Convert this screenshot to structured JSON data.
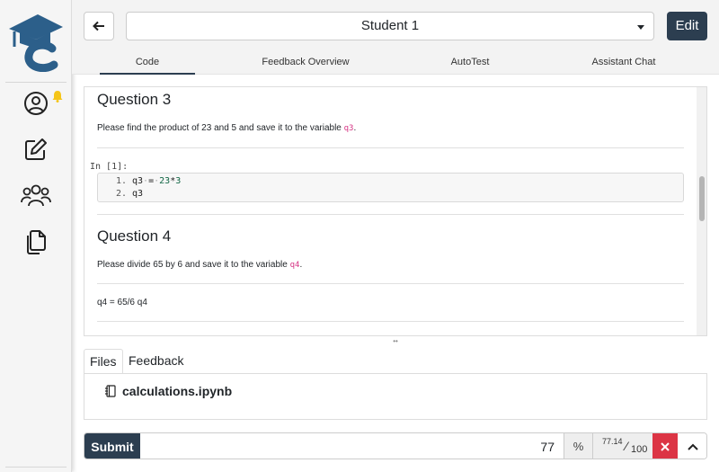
{
  "sidebar": {
    "logo": "codegrade-logo",
    "icons": [
      "user-icon",
      "notification-bell-icon",
      "edit-icon",
      "users-icon",
      "copy-icon"
    ],
    "accent": "#2c5f8a",
    "bell_color": "#f5c518"
  },
  "header": {
    "student": "Student 1",
    "edit_label": "Edit"
  },
  "tabs": [
    {
      "label": "Code",
      "active": true
    },
    {
      "label": "Feedback Overview"
    },
    {
      "label": "AutoTest"
    },
    {
      "label": "Assistant Chat"
    }
  ],
  "notebook": {
    "q3": {
      "title": "Question 3",
      "text_before": "Please find the product of 23 and 5 and save it to the variable ",
      "var": "q3",
      "text_after": "."
    },
    "prompt": "In [1]:",
    "code": [
      {
        "num": "1.",
        "code": "q3 = 23*3"
      },
      {
        "num": "2.",
        "code": "q3"
      }
    ],
    "q4": {
      "title": "Question 4",
      "text_before": "Please divide 65 by 6 and save it to the variable ",
      "var": "q4",
      "text_after": ".",
      "answer": "q4 = 65/6 q4"
    }
  },
  "file_tabs": [
    {
      "label": "Files",
      "active": true
    },
    {
      "label": "Feedback"
    }
  ],
  "files": [
    {
      "name": "calculations.ipynb",
      "icon": "notebook-icon"
    }
  ],
  "grade": {
    "submit_label": "Submit",
    "value": "77",
    "percent_symbol": "%",
    "score": "77.14",
    "max": "100"
  },
  "colors": {
    "primary": "#2c3e50",
    "danger": "#dc3545",
    "code_var": "#d63384"
  }
}
